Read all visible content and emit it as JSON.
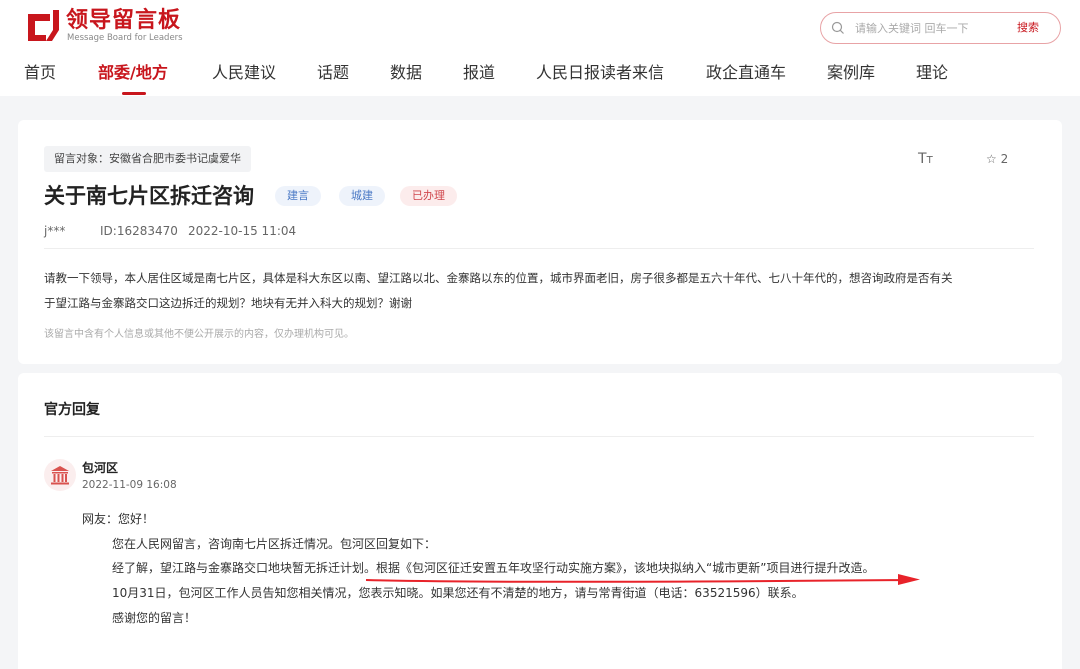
{
  "header": {
    "logo_title": "领导留言板",
    "logo_subtitle": "Message Board for Leaders",
    "search_placeholder": "请输入关键词 回车一下",
    "search_button": "搜索"
  },
  "nav": {
    "items": [
      "首页",
      "部委/地方",
      "人民建议",
      "话题",
      "数据",
      "报道",
      "人民日报读者来信",
      "政企直通车",
      "案例库",
      "理论"
    ],
    "active_index": 1
  },
  "message": {
    "target": "留言对象：安徽省合肥市委书记虞爱华",
    "font_icon_label": "TT",
    "star_count": "2",
    "title": "关于南七片区拆迁咨询",
    "tags": [
      "建言",
      "城建",
      "已办理"
    ],
    "author": "j***",
    "id": "ID:16283470",
    "datetime": "2022-10-15 11:04",
    "body_line1": "请教一下领导，本人居住区域是南七片区，具体是科大东区以南、望江路以北、金寨路以东的位置，城市界面老旧，房子很多都是五六十年代、七八十年代的，想咨询政府是否有关",
    "body_line2": "于望江路与金寨路交口这边拆迁的规划？地块有无并入科大的规划？谢谢",
    "privacy_note": "该留言中含有个人信息或其他不便公开展示的内容，仅办理机构可见。"
  },
  "reply": {
    "heading": "官方回复",
    "org": "包河区",
    "datetime": "2022-11-09 16:08",
    "greeting": "网友：您好！",
    "lines": [
      "您在人民网留言，咨询南七片区拆迁情况。包河区回复如下：",
      "经了解，望江路与金寨路交口地块暂无拆迁计划。根据《包河区征迁安置五年攻坚行动实施方案》，该地块拟纳入“城市更新”项目进行提升改造。",
      "10月31日，包河区工作人员告知您相关情况，您表示知晓。如果您还有不清楚的地方，请与常青街道（电话：63521596）联系。",
      "感谢您的留言！"
    ]
  },
  "colors": {
    "brand_red": "#c8161d",
    "tag_blue": "#4a79c5",
    "tag_red": "#d0474d"
  }
}
